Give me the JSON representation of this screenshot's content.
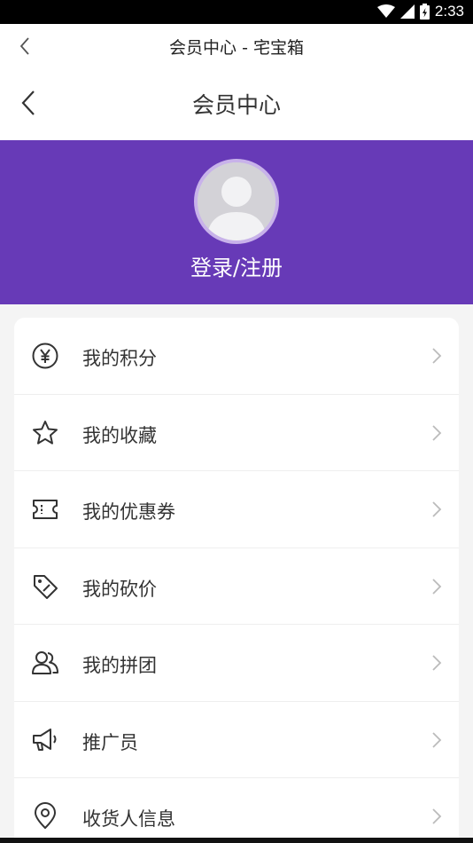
{
  "status_bar": {
    "time": "2:33"
  },
  "webview": {
    "title": "会员中心 - 宅宝箱"
  },
  "header": {
    "title": "会员中心"
  },
  "profile": {
    "login_label": "登录/注册"
  },
  "menu": {
    "items": [
      {
        "label": "我的积分",
        "icon": "yen-coin-icon"
      },
      {
        "label": "我的收藏",
        "icon": "star-icon"
      },
      {
        "label": "我的优惠券",
        "icon": "ticket-icon"
      },
      {
        "label": "我的砍价",
        "icon": "price-tag-icon"
      },
      {
        "label": "我的拼团",
        "icon": "users-icon"
      },
      {
        "label": "推广员",
        "icon": "megaphone-icon"
      },
      {
        "label": "收货人信息",
        "icon": "location-pin-icon"
      }
    ]
  },
  "colors": {
    "accent": "#673ab7",
    "avatar_ring": "#c8b2ea",
    "text": "#333333"
  }
}
